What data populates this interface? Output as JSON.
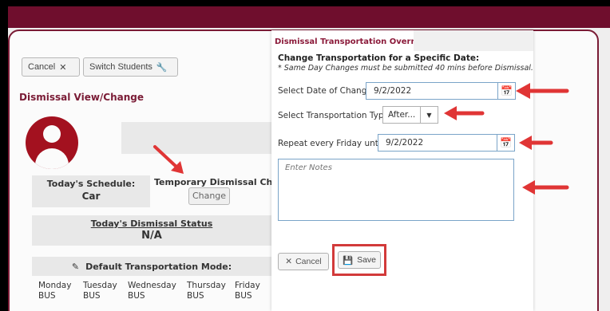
{
  "background": {
    "cancel_label": "Cancel",
    "switch_label": "Switch Students",
    "page_title": "Dismissal View/Change",
    "schedule": {
      "label": "Today's Schedule:",
      "value": "Car"
    },
    "temp_changes": {
      "label": "Temporary Dismissal Changes",
      "change_label": "Change"
    },
    "status": {
      "label": "Today's Dismissal Status",
      "value": "N/A"
    },
    "mode_label": "Default Transportation Mode:",
    "days": [
      {
        "day": "Monday",
        "mode": "BUS"
      },
      {
        "day": "Tuesday",
        "mode": "BUS"
      },
      {
        "day": "Wednesday",
        "mode": "BUS"
      },
      {
        "day": "Thursday",
        "mode": "BUS"
      },
      {
        "day": "Friday",
        "mode": "BUS"
      }
    ]
  },
  "modal": {
    "title": "Dismissal Transportation Override for",
    "subtitle": "Change Transportation for a Specific Date:",
    "note": "* Same Day Changes must be submitted 40 mins before Dismissal.",
    "date_label": "Select Date of Change:",
    "date_value": "9/2/2022",
    "type_label": "Select Transportation Type:",
    "type_value": "After...",
    "repeat_label": "Repeat every Friday until :",
    "repeat_value": "9/2/2022",
    "notes_placeholder": "Enter Notes",
    "cancel_label": "Cancel",
    "save_label": "Save"
  },
  "colors": {
    "brand": "#6f0e2d",
    "accent_text": "#8b1a3a",
    "annotation": "#e03535",
    "input_border": "#7aa4c8"
  }
}
